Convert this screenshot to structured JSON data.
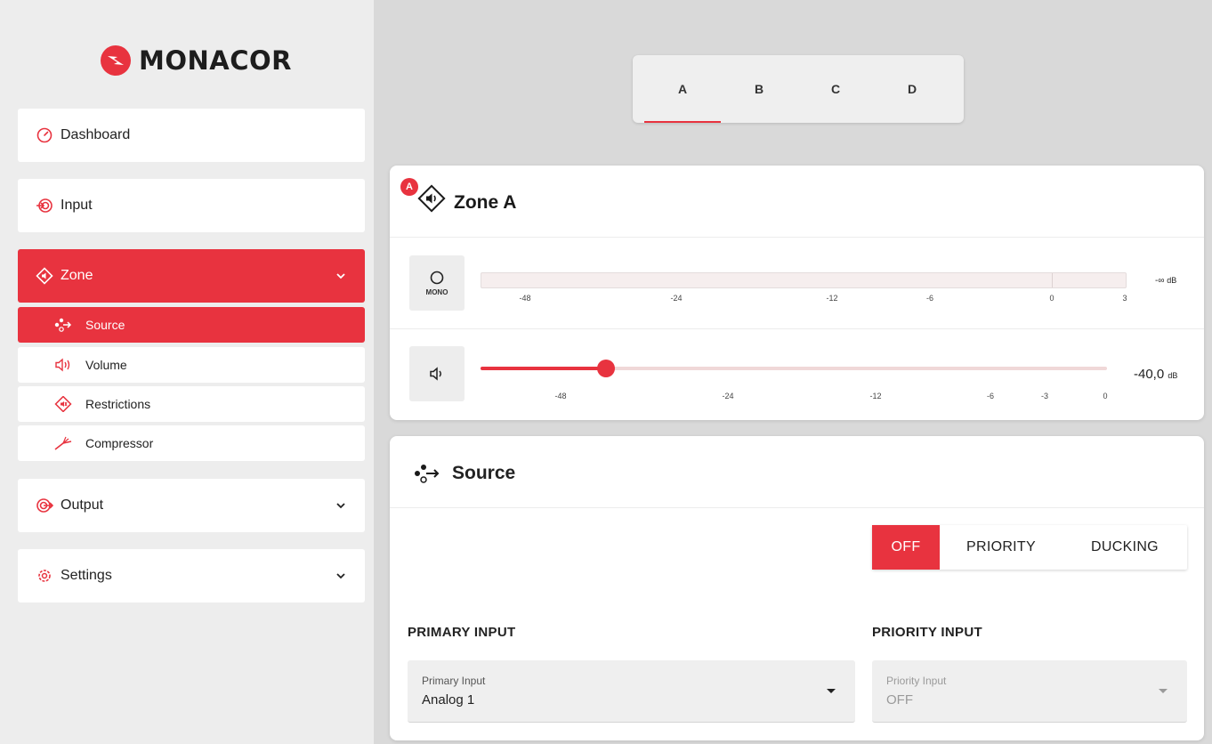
{
  "brand": {
    "name": "MONACOR",
    "accent": "#e8333f"
  },
  "sidebar": {
    "items": [
      {
        "label": "Dashboard",
        "icon": "gauge-icon"
      },
      {
        "label": "Input",
        "icon": "input-icon"
      },
      {
        "label": "Zone",
        "icon": "zone-speaker-icon",
        "expanded": true
      },
      {
        "label": "Output",
        "icon": "output-icon"
      },
      {
        "label": "Settings",
        "icon": "gear-icon"
      }
    ],
    "zone_sub": [
      {
        "label": "Source",
        "icon": "source-nodes-icon",
        "active": true
      },
      {
        "label": "Volume",
        "icon": "speaker-icon"
      },
      {
        "label": "Restrictions",
        "icon": "restriction-icon"
      },
      {
        "label": "Compressor",
        "icon": "compressor-icon"
      }
    ]
  },
  "zone_tabs": [
    "A",
    "B",
    "C",
    "D"
  ],
  "zone_card": {
    "badge": "A",
    "title": "Zone A",
    "mono_label": "MONO",
    "meter_scale": [
      "-48",
      "-24",
      "-12",
      "-6",
      "0",
      "3"
    ],
    "meter_value": "-∞",
    "meter_unit": "dB",
    "volume_scale": [
      "-48",
      "-24",
      "-12",
      "-6",
      "-3",
      "0"
    ],
    "volume_value": "-40,0",
    "volume_unit": "dB",
    "volume_level_fraction": 0.2
  },
  "source_card": {
    "title": "Source",
    "modes": [
      "OFF",
      "PRIORITY",
      "DUCKING"
    ],
    "active_mode": "OFF",
    "primary": {
      "section": "PRIMARY INPUT",
      "field_label": "Primary Input",
      "value": "Analog 1"
    },
    "priority": {
      "section": "PRIORITY INPUT",
      "field_label": "Priority Input",
      "value": "OFF"
    }
  }
}
